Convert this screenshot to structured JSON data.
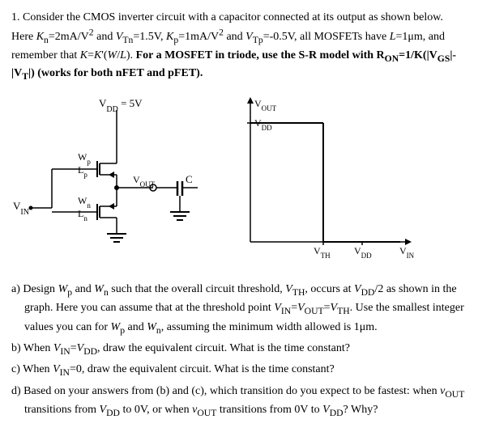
{
  "problem": {
    "number": "1.",
    "intro": "Consider the CMOS inverter circuit with a capacitor connected at its output as shown below. Here K",
    "kn_sub": "n",
    "kn_val": "=2mA/V",
    "kn_sup": "2",
    "and": " and V",
    "vtn_sub": "Tn",
    "vtn_val": "=1.5V, K",
    "kp_sub": "p",
    "kp_val": "=1mA/V",
    "kp_sup": "2",
    "and2": " and V",
    "vtp_sub": "Tp",
    "vtp_val": "=-0.5V, all MOSFETs have L=1",
    "micron": "μ",
    "lrest": "m, and remember that K=K'(W/L).",
    "bold_note": " For a MOSFET in triode, use the S-R model with R",
    "ron_sub": "ON",
    "ron_val": "=1/K(|V",
    "vgs_sub": "GS",
    "vgs_val": "|-|V",
    "vt_sub": "T",
    "vt_val": "|) (works for both nFET and pFET)."
  },
  "parts": {
    "a_label": "a)",
    "a_text": "Design W",
    "a_wp": "p",
    "a_text2": " and W",
    "a_wn": "n",
    "a_text3": " such that the overall circuit threshold, V",
    "a_vth": "TH",
    "a_text4": ", occurs at V",
    "a_vdd": "DD",
    "a_text5": "/2 as shown in the graph.  Here you can assume that at the threshold point V",
    "a_vin": "IN",
    "a_eq": "=V",
    "a_vout": "OUT",
    "a_eq2": "=V",
    "a_vth2": "TH",
    "a_text6": ".  Use the smallest integer values you can for W",
    "a_wp2": "p",
    "a_text7": " and W",
    "a_wn2": "n",
    "a_text8": ", assuming the minimum width allowed is 1",
    "a_mu": "μ",
    "a_text9": "m.",
    "b_label": "b)",
    "b_text": "When V",
    "b_vin": "IN",
    "b_eq": "=V",
    "b_vdd": "DD",
    "b_text2": ", draw the equivalent circuit.  What is the time constant?",
    "c_label": "c)",
    "c_text": "When V",
    "c_vin": "IN",
    "c_eq": "=0, draw the equivalent circuit.  What is the time constant?",
    "d_label": "d)",
    "d_text": "Based on your answers from (b) and (c), which transition do you expect to be fastest: when v",
    "d_vout": "OUT",
    "d_text2": " transitions from V",
    "d_vdd": "DD",
    "d_text3": " to 0V, or when v",
    "d_vout2": "OUT",
    "d_text4": " transitions from 0V to V",
    "d_vdd2": "DD",
    "d_text5": "? Why?"
  }
}
